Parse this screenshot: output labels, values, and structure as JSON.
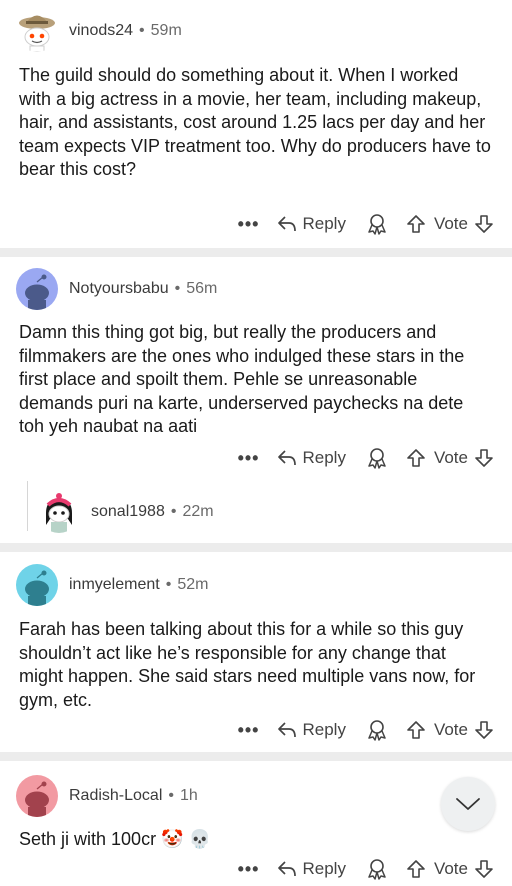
{
  "comments": [
    {
      "username": "vinods24",
      "age": "59m",
      "text": "The guild should do something about it. When I worked with a big actress in a movie, her team, including makeup, hair, and assistants, cost around 1.25 lacs per day and her team expects VIP treatment too. Why do producers have to bear this cost?",
      "avatar_color": "#d9dde0"
    },
    {
      "username": "Notyoursbabu",
      "age": "56m",
      "text": "Damn this thing got big, but really the producers and filmmakers are the ones who indulged these stars in the first place and spoilt them. Pehle se unreasonable demands puri na karte, underserved paychecks na dete toh yeh naubat na aati",
      "avatar_color": "#9aa8f2"
    },
    {
      "username": "sonal1988",
      "age": "22m",
      "avatar_color": "#ffffff"
    },
    {
      "username": "inmyelement",
      "age": "52m",
      "text": "Farah has been talking about this for a while so this guy shouldn’t act like he’s responsible for any change that might happen. She said stars need multiple vans now, for gym, etc.",
      "avatar_color": "#6fd3e8"
    },
    {
      "username": "Radish-Local",
      "age": "1h",
      "text": "Seth ji with 100cr 🤡 💀",
      "avatar_color": "#f29aa2"
    }
  ],
  "labels": {
    "more": "•••",
    "reply": "Reply",
    "vote": "Vote",
    "separator": "•"
  },
  "icons": {
    "reply": "reply-arrow-icon",
    "award": "award-icon",
    "upvote": "upvote-arrow-icon",
    "downvote": "downvote-arrow-icon",
    "scroll": "chevron-down-icon"
  },
  "colors": {
    "text": "#1a1a1a",
    "meta": "#6a6a6a",
    "separator": "#ececec",
    "fab": "#eef0f1"
  }
}
